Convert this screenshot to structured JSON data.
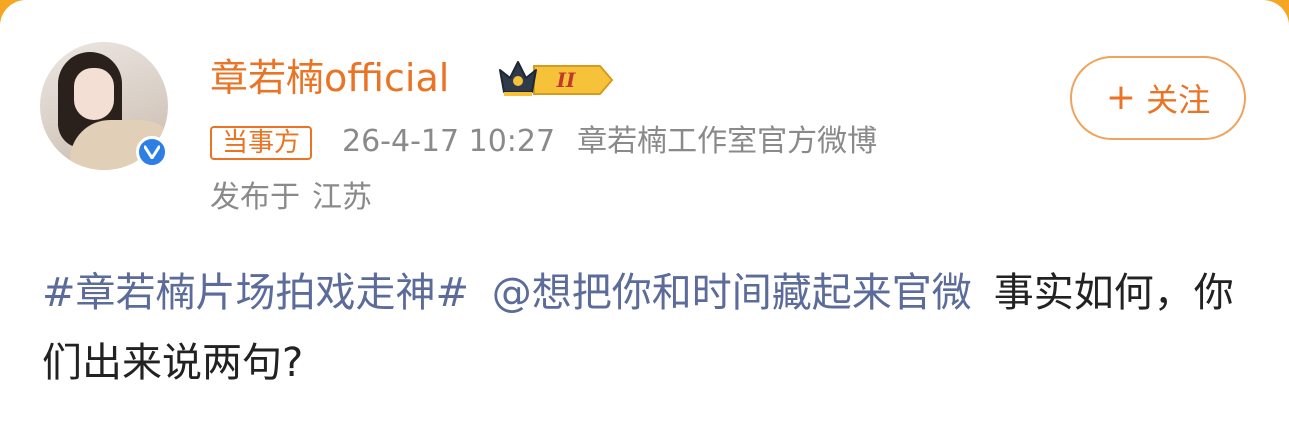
{
  "post": {
    "author_name": "章若楠official",
    "party_tag": "当事方",
    "time": "26-4-17 10:27",
    "source": "章若楠工作室官方微博",
    "location_label": "发布于",
    "location": "江苏",
    "follow_label": "关注",
    "follow_plus": "+",
    "crown_level": "II",
    "content": {
      "hashtag": "#章若楠片场拍戏走神#",
      "mention": "@想把你和时间藏起来官微",
      "text": "事实如何，你们出来说两句?"
    }
  },
  "colors": {
    "accent": "#eb7324",
    "link": "#5b6b9a",
    "meta": "#8a8a8a",
    "verify": "#2d7fe6"
  },
  "icons": [
    "verified-badge-icon",
    "crown-badge-icon"
  ]
}
